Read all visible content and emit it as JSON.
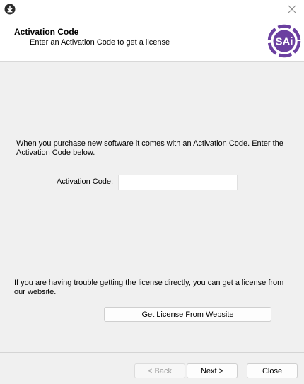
{
  "header": {
    "title": "Activation Code",
    "subtitle": "Enter an Activation Code to get a license",
    "logo_text": "SAi"
  },
  "icons": {
    "app": "download-circle-icon",
    "close": "close-icon"
  },
  "colors": {
    "logo_purple": "#6b3fa0"
  },
  "main": {
    "intro_text": "When you purchase new software it comes with an Activation Code.  Enter the Activation Code below.",
    "activation_label": "Activation Code:",
    "activation_value": "",
    "trouble_text": "If you are having trouble getting the license directly, you can get a license from our website.",
    "website_button": "Get License From Website"
  },
  "footer": {
    "back_label": "< Back",
    "next_label": "Next >",
    "close_label": "Close"
  }
}
